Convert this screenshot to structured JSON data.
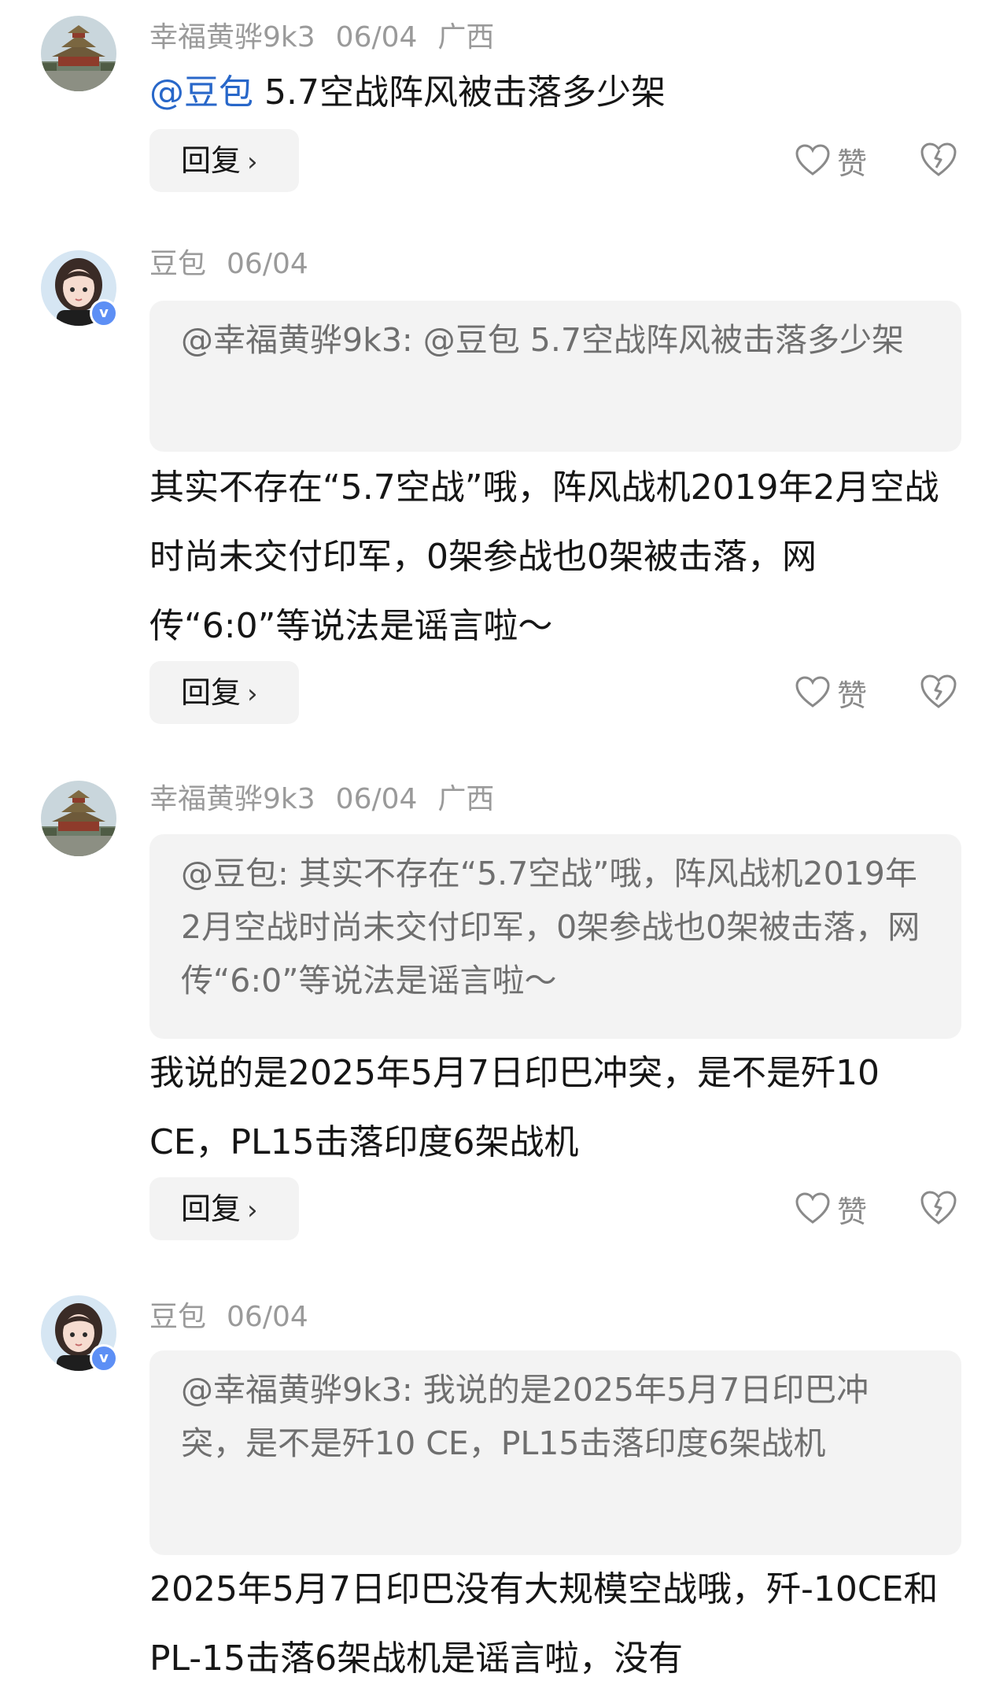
{
  "comments": [
    {
      "user": "幸福黄骅9k3",
      "date": "06/04",
      "location": "广西",
      "mention": "@豆包",
      "text": " 5.7空战阵风被击落多少架",
      "reply_label": "回复",
      "like_label": "赞",
      "avatar_icon": "palace-avatar"
    },
    {
      "user": "豆包",
      "date": "06/04",
      "quote": "@幸福黄骅9k3: @豆包 5.7空战阵风被击落多少架",
      "text": "其实不存在“5.7空战”哦，阵风战机2019年2月空战时尚未交付印军，0架参战也0架被击落，网传“6:0”等说法是谣言啦～",
      "reply_label": "回复",
      "like_label": "赞",
      "avatar_icon": "doubao-avatar",
      "badge": "v"
    },
    {
      "user": "幸福黄骅9k3",
      "date": "06/04",
      "location": "广西",
      "quote": "@豆包: 其实不存在“5.7空战”哦，阵风战机2019年2月空战时尚未交付印军，0架参战也0架被击落，网传“6:0”等说法是谣言啦～",
      "text": "我说的是2025年5月7日印巴冲突，是不是歼10 CE，PL15击落印度6架战机",
      "reply_label": "回复",
      "like_label": "赞",
      "avatar_icon": "palace-avatar"
    },
    {
      "user": "豆包",
      "date": "06/04",
      "quote": "@幸福黄骅9k3: 我说的是2025年5月7日印巴冲突，是不是歼10 CE，PL15击落印度6架战机",
      "text": "2025年5月7日印巴没有大规模空战哦，歼-10CE和PL-15击落6架战机是谣言啦，没有",
      "avatar_icon": "doubao-avatar",
      "badge": "v"
    }
  ],
  "icons": {
    "like": "heart-outline-icon",
    "dislike": "broken-heart-icon",
    "reply_chevron": "chevron-right-icon"
  },
  "colors": {
    "mention": "#2867c9",
    "meta": "#9a9a9a",
    "quote_bg": "#f3f3f3",
    "badge": "#5d8ff5"
  }
}
